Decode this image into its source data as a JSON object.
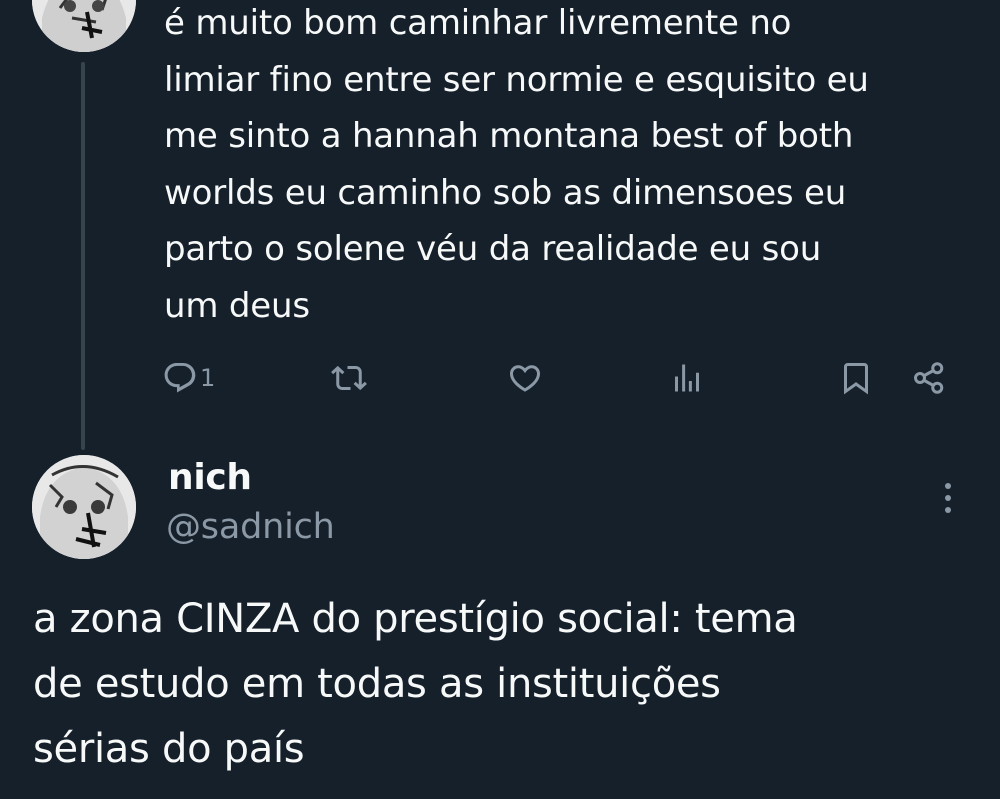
{
  "parent_tweet": {
    "text": "é muito bom caminhar livremente no\nlimiar fino entre ser normie e esquisito eu\nme sinto a hannah montana best of both\nworlds eu caminho sob as dimensoes eu\nparto o solene véu da realidade eu sou\num deus",
    "reply_count": "1",
    "actions": {
      "reply_icon": "reply-icon",
      "retweet_icon": "retweet-icon",
      "like_icon": "like-icon",
      "views_icon": "views-icon",
      "bookmark_icon": "bookmark-icon",
      "share_icon": "share-icon"
    }
  },
  "main_tweet": {
    "display_name": "nich",
    "handle": "@sadnich",
    "text": "a zona CINZA do prestígio social: tema\nde estudo em todas as instituições\nsérias do país",
    "more_icon": "more-vertical-icon"
  },
  "colors": {
    "background": "#15202b",
    "text_primary": "#f7f9f9",
    "text_secondary": "#8b98a5",
    "thread_line": "#38444d"
  }
}
